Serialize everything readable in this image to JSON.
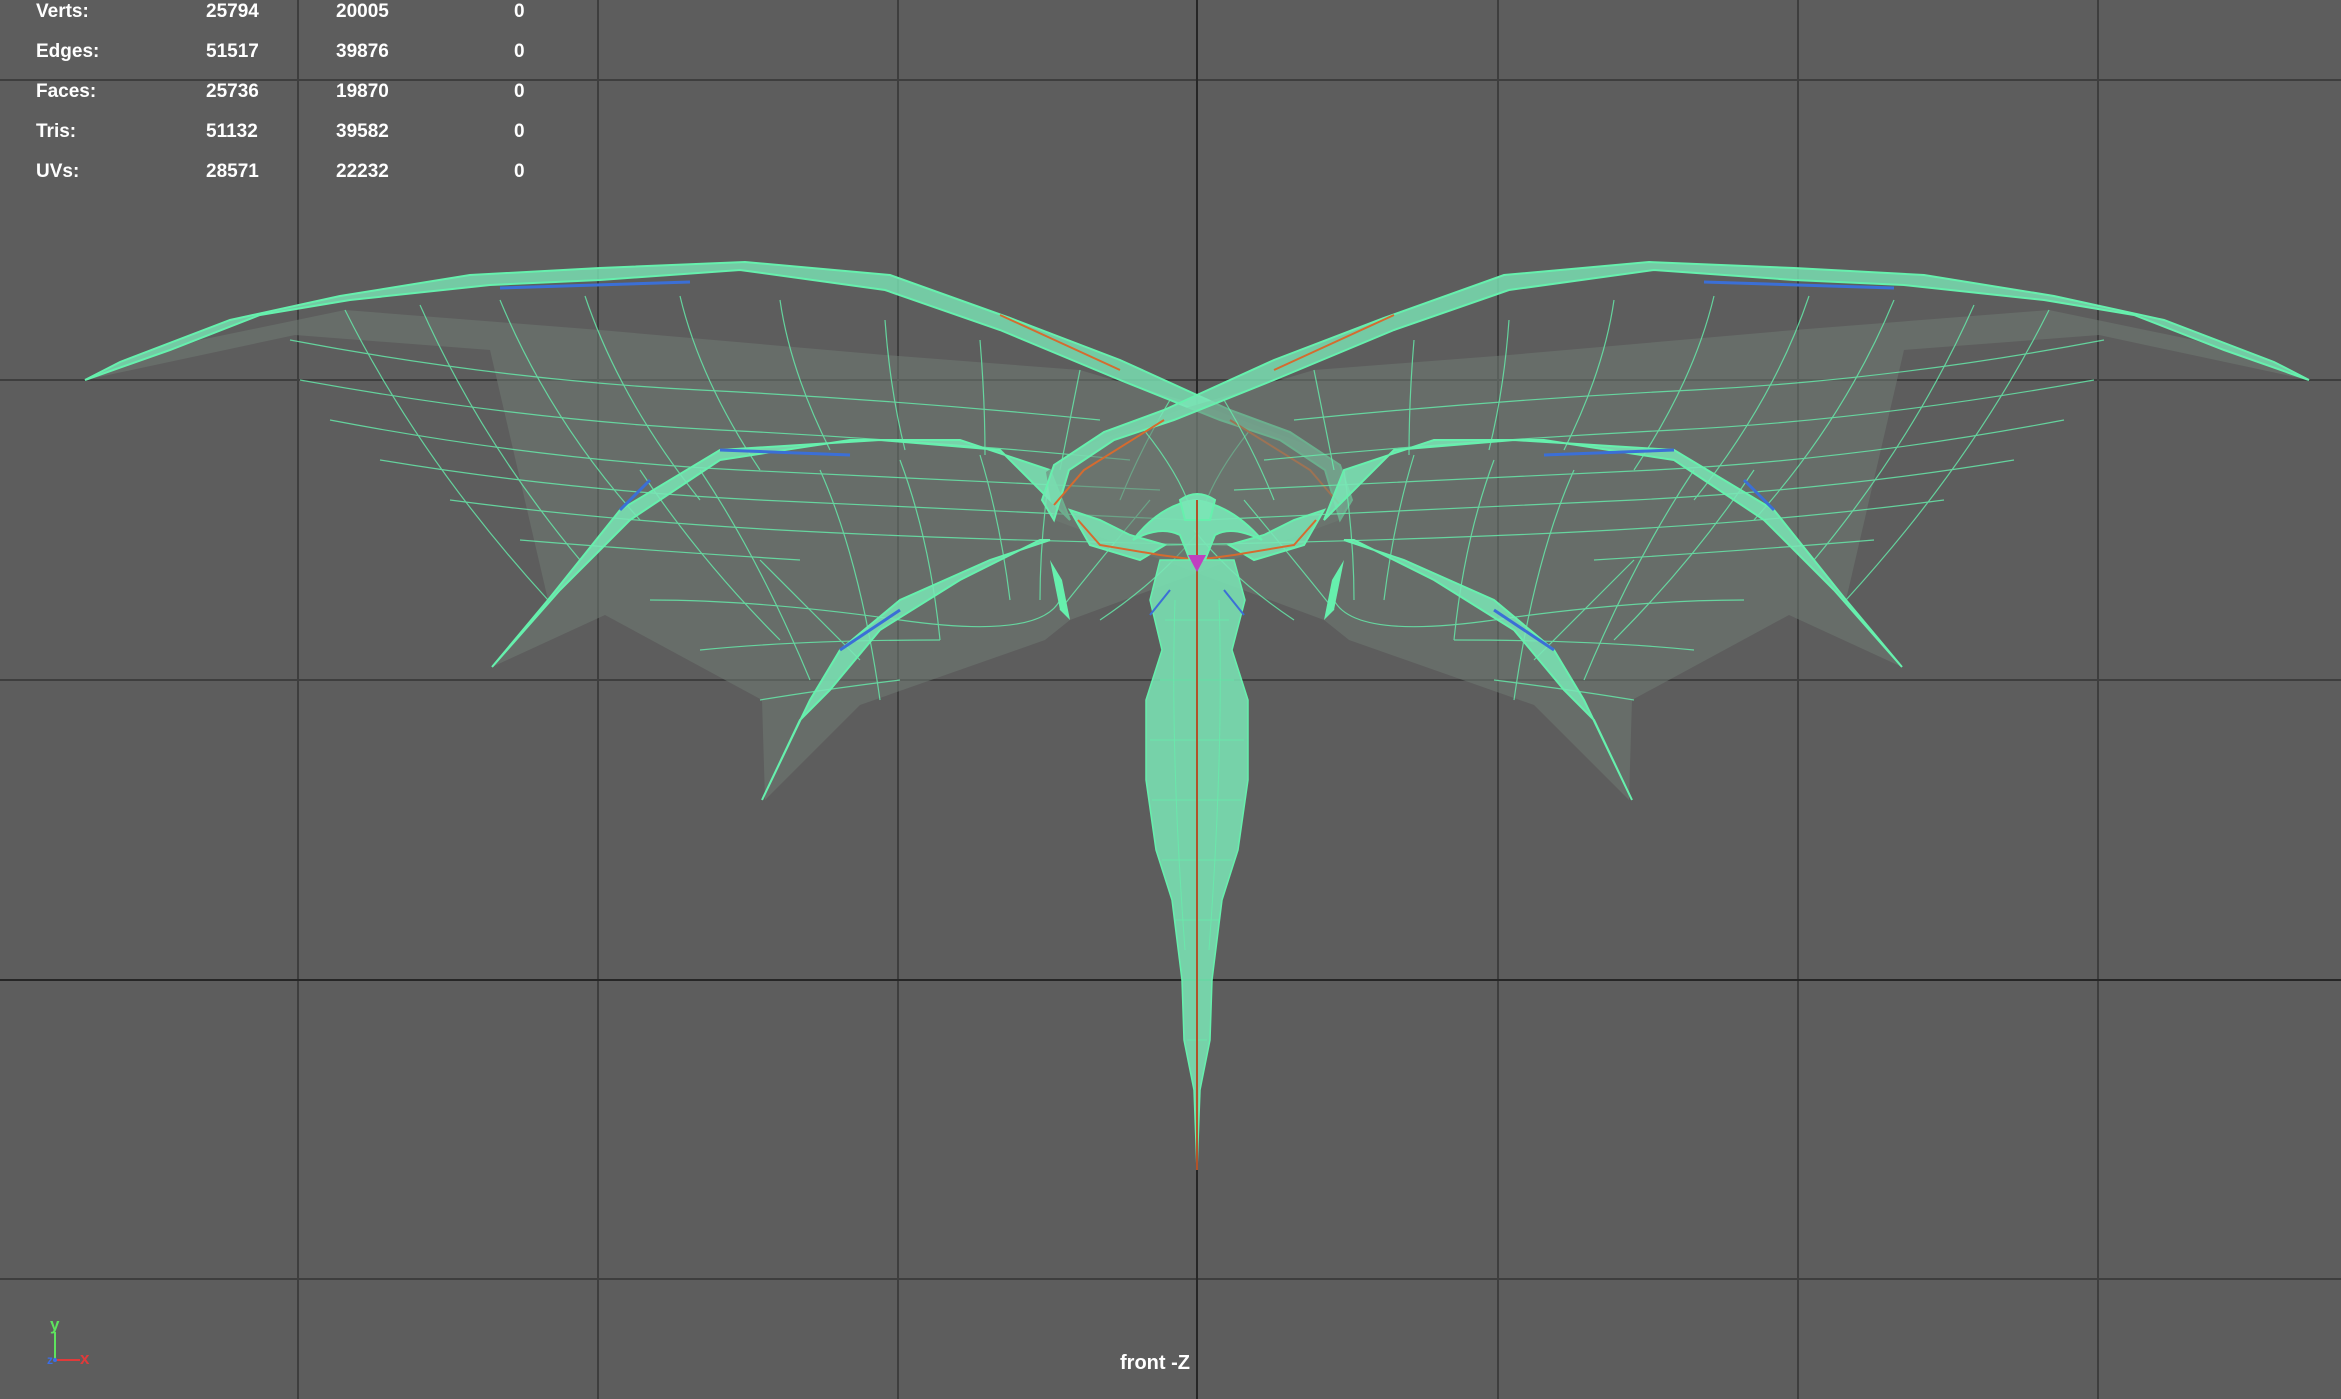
{
  "hud": {
    "rows": [
      {
        "label": "Verts:",
        "v1": "25794",
        "v2": "20005",
        "v3": "0"
      },
      {
        "label": "Edges:",
        "v1": "51517",
        "v2": "39876",
        "v3": "0"
      },
      {
        "label": "Faces:",
        "v1": "25736",
        "v2": "19870",
        "v3": "0"
      },
      {
        "label": "Tris:",
        "v1": "51132",
        "v2": "39582",
        "v3": "0"
      },
      {
        "label": "UVs:",
        "v1": "28571",
        "v2": "22232",
        "v3": "0"
      }
    ]
  },
  "viewport": {
    "camera_label": "front -Z",
    "background_color": "#5d5d5d",
    "grid_color": "#3e3e3e",
    "axis_line_color": "#262626",
    "mesh_color": "#66f0ad"
  },
  "axis_gizmo": {
    "y": "y",
    "x": "x",
    "z": "z",
    "colors": {
      "x": "#e03a3a",
      "y": "#5ee35e",
      "z": "#3a6ee8"
    }
  }
}
